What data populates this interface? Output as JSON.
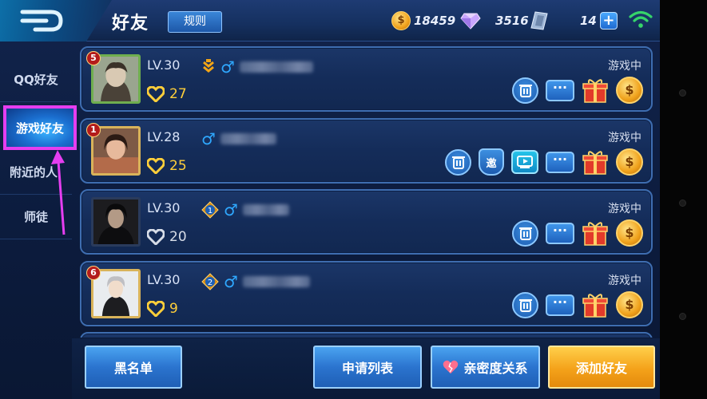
{
  "header": {
    "title": "好友",
    "rules_label": "规则",
    "coins": "18459",
    "diamonds": "3516",
    "coupons": "14",
    "coin_glyph": "$"
  },
  "sidebar": {
    "items": [
      {
        "label": "QQ好友"
      },
      {
        "label": "游戏好友",
        "active": true
      },
      {
        "label": "附近的人"
      },
      {
        "label": "师徒"
      }
    ]
  },
  "friends": [
    {
      "rank": "5",
      "level": "LV.30",
      "intimacy": "27",
      "status": "游戏中",
      "heart_color": "gold",
      "gender": "♂"
    },
    {
      "rank": "1",
      "level": "LV.28",
      "intimacy": "25",
      "status": "游戏中",
      "heart_color": "gold",
      "gender": "♂",
      "invite_label": "邀"
    },
    {
      "rank": "",
      "level": "LV.30",
      "intimacy": "20",
      "status": "游戏中",
      "heart_color": "grey",
      "gender": "♂",
      "badge": "1"
    },
    {
      "rank": "6",
      "level": "LV.30",
      "intimacy": "9",
      "status": "游戏中",
      "heart_color": "gold",
      "gender": "♂",
      "badge": "2"
    }
  ],
  "footer": {
    "blacklist": "黑名单",
    "requests": "申请列表",
    "intimacy_relations": "亲密度关系",
    "add_friend": "添加好友"
  },
  "colors": {
    "highlight": "#e53ef0",
    "male": "#2fa8ff",
    "gold": "#ffcf3a"
  },
  "icons": [
    "back-icon",
    "coin-icon",
    "diamond-icon",
    "coupon-icon",
    "wifi-icon",
    "delete-icon",
    "message-icon",
    "gift-icon",
    "coin-send-icon",
    "video-icon",
    "heart-icon",
    "male-icon"
  ]
}
